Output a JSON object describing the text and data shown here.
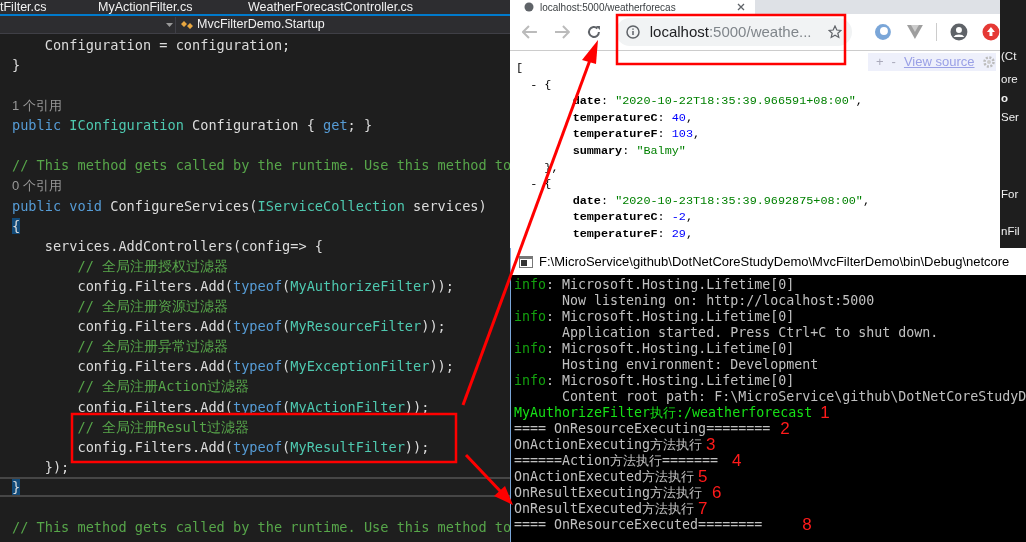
{
  "editor": {
    "tabs": [
      "tFilter.cs",
      "MyActionFilter.cs",
      "WeatherForecastController.cs"
    ],
    "member_dropdown": "MvcFilterDemo.Startup",
    "code_lines": [
      {
        "kind": "code",
        "tokens": [
          {
            "kind": "plain",
            "text": "    Configuration = configuration;"
          }
        ]
      },
      {
        "kind": "code",
        "tokens": [
          {
            "kind": "plain",
            "text": "}"
          }
        ]
      },
      {
        "kind": "blank"
      },
      {
        "kind": "codelens",
        "text": "1 个引用"
      },
      {
        "kind": "code",
        "tokens": [
          {
            "kind": "keyword",
            "text": "public "
          },
          {
            "kind": "type",
            "text": "IConfiguration"
          },
          {
            "kind": "plain",
            "text": " Configuration { "
          },
          {
            "kind": "keyword",
            "text": "get"
          },
          {
            "kind": "plain",
            "text": "; }"
          }
        ]
      },
      {
        "kind": "blank"
      },
      {
        "kind": "code",
        "tokens": [
          {
            "kind": "comment",
            "text": "// This method gets called by the runtime. Use this method to"
          }
        ]
      },
      {
        "kind": "codelens",
        "text": "0 个引用"
      },
      {
        "kind": "code",
        "tokens": [
          {
            "kind": "keyword",
            "text": "public void "
          },
          {
            "kind": "plain",
            "text": "ConfigureServices("
          },
          {
            "kind": "type",
            "text": "IServiceCollection"
          },
          {
            "kind": "plain",
            "text": " services)"
          }
        ]
      },
      {
        "kind": "code",
        "tokens": [
          {
            "kind": "brace",
            "text": "{"
          }
        ]
      },
      {
        "kind": "code",
        "tokens": [
          {
            "kind": "plain",
            "text": "    services.AddControllers(config=> {"
          }
        ]
      },
      {
        "kind": "code",
        "tokens": [
          {
            "kind": "comment",
            "text": "        // 全局注册授权过滤器"
          }
        ]
      },
      {
        "kind": "code",
        "tokens": [
          {
            "kind": "plain",
            "text": "        config.Filters.Add("
          },
          {
            "kind": "keyword",
            "text": "typeof"
          },
          {
            "kind": "plain",
            "text": "("
          },
          {
            "kind": "type",
            "text": "MyAuthorizeFilter"
          },
          {
            "kind": "plain",
            "text": "));"
          }
        ]
      },
      {
        "kind": "code",
        "tokens": [
          {
            "kind": "comment",
            "text": "        // 全局注册资源过滤器"
          }
        ]
      },
      {
        "kind": "code",
        "tokens": [
          {
            "kind": "plain",
            "text": "        config.Filters.Add("
          },
          {
            "kind": "keyword",
            "text": "typeof"
          },
          {
            "kind": "plain",
            "text": "("
          },
          {
            "kind": "type",
            "text": "MyResourceFilter"
          },
          {
            "kind": "plain",
            "text": "));"
          }
        ]
      },
      {
        "kind": "code",
        "tokens": [
          {
            "kind": "comment",
            "text": "        // 全局注册异常过滤器"
          }
        ]
      },
      {
        "kind": "code",
        "tokens": [
          {
            "kind": "plain",
            "text": "        config.Filters.Add("
          },
          {
            "kind": "keyword",
            "text": "typeof"
          },
          {
            "kind": "plain",
            "text": "("
          },
          {
            "kind": "type",
            "text": "MyExceptionFilter"
          },
          {
            "kind": "plain",
            "text": "));"
          }
        ]
      },
      {
        "kind": "code",
        "tokens": [
          {
            "kind": "comment",
            "text": "        // 全局注册Action过滤器"
          }
        ]
      },
      {
        "kind": "code",
        "tokens": [
          {
            "kind": "plain",
            "text": "        config.Filters.Add("
          },
          {
            "kind": "keyword",
            "text": "typeof"
          },
          {
            "kind": "plain",
            "text": "("
          },
          {
            "kind": "type",
            "text": "MyActionFilter"
          },
          {
            "kind": "plain",
            "text": "));"
          }
        ]
      },
      {
        "kind": "code",
        "tokens": [
          {
            "kind": "comment",
            "text": "        // 全局注册Result过滤器"
          }
        ]
      },
      {
        "kind": "code",
        "tokens": [
          {
            "kind": "plain",
            "text": "        config.Filters.Add("
          },
          {
            "kind": "keyword",
            "text": "typeof"
          },
          {
            "kind": "plain",
            "text": "("
          },
          {
            "kind": "type",
            "text": "MyResultFilter"
          },
          {
            "kind": "plain",
            "text": "));"
          }
        ]
      },
      {
        "kind": "code",
        "tokens": [
          {
            "kind": "plain",
            "text": "    });"
          }
        ]
      },
      {
        "kind": "current",
        "tokens": [
          {
            "kind": "brace",
            "text": "}"
          }
        ]
      },
      {
        "kind": "blank"
      },
      {
        "kind": "code",
        "tokens": [
          {
            "kind": "comment",
            "text": "// This method gets called by the runtime. Use this method to"
          }
        ]
      }
    ]
  },
  "browser": {
    "tab_title": "localhost:5000/weatherforecas",
    "address_host": "localhost",
    "address_rest": ":5000/weathe...",
    "viewer_controls": [
      "+",
      "-"
    ],
    "view_source": "View source",
    "json_lines": [
      [
        {
          "kind": "punct",
          "text": "["
        }
      ],
      [
        {
          "kind": "punct",
          "text": "  - {"
        }
      ],
      [
        {
          "kind": "key",
          "text": "        date"
        },
        {
          "kind": "punct",
          "text": ": "
        },
        {
          "kind": "string",
          "text": "\"2020-10-22T18:35:39.966591+08:00\""
        },
        {
          "kind": "punct",
          "text": ","
        }
      ],
      [
        {
          "kind": "key",
          "text": "        temperatureC"
        },
        {
          "kind": "punct",
          "text": ": "
        },
        {
          "kind": "number",
          "text": "40"
        },
        {
          "kind": "punct",
          "text": ","
        }
      ],
      [
        {
          "kind": "key",
          "text": "        temperatureF"
        },
        {
          "kind": "punct",
          "text": ": "
        },
        {
          "kind": "number",
          "text": "103"
        },
        {
          "kind": "punct",
          "text": ","
        }
      ],
      [
        {
          "kind": "key",
          "text": "        summary"
        },
        {
          "kind": "punct",
          "text": ": "
        },
        {
          "kind": "string",
          "text": "\"Balmy\""
        }
      ],
      [
        {
          "kind": "punct",
          "text": "    },"
        }
      ],
      [
        {
          "kind": "punct",
          "text": "  - {"
        }
      ],
      [
        {
          "kind": "key",
          "text": "        date"
        },
        {
          "kind": "punct",
          "text": ": "
        },
        {
          "kind": "string",
          "text": "\"2020-10-23T18:35:39.9692875+08:00\""
        },
        {
          "kind": "punct",
          "text": ","
        }
      ],
      [
        {
          "kind": "key",
          "text": "        temperatureC"
        },
        {
          "kind": "punct",
          "text": ": "
        },
        {
          "kind": "number",
          "text": "-2"
        },
        {
          "kind": "punct",
          "text": ","
        }
      ],
      [
        {
          "kind": "key",
          "text": "        temperatureF"
        },
        {
          "kind": "punct",
          "text": ": "
        },
        {
          "kind": "number",
          "text": "29"
        },
        {
          "kind": "punct",
          "text": ","
        }
      ]
    ]
  },
  "side_strip": [
    "(Ct",
    "ore",
    "o",
    "Ser",
    "For",
    "nFil"
  ],
  "console": {
    "title": "F:\\MicroService\\github\\DotNetCoreStudyDemo\\MvcFilterDemo\\bin\\Debug\\netcore",
    "lines": [
      {
        "kind": "info",
        "prefix": "info",
        "text": ": Microsoft.Hosting.Lifetime[0]"
      },
      {
        "kind": "plain",
        "text": "      Now listening on: http://localhost:5000"
      },
      {
        "kind": "info",
        "prefix": "info",
        "text": ": Microsoft.Hosting.Lifetime[0]"
      },
      {
        "kind": "plain",
        "text": "      Application started. Press Ctrl+C to shut down."
      },
      {
        "kind": "info",
        "prefix": "info",
        "text": ": Microsoft.Hosting.Lifetime[0]"
      },
      {
        "kind": "plain",
        "text": "      Hosting environment: Development"
      },
      {
        "kind": "info",
        "prefix": "info",
        "text": ": Microsoft.Hosting.Lifetime[0]"
      },
      {
        "kind": "plain",
        "text": "      Content root path: F:\\MicroService\\github\\DotNetCoreStudyD"
      },
      {
        "kind": "bright",
        "text": "MyAuthorizeFilter执行:/weatherforecast",
        "note": "1"
      },
      {
        "kind": "plain",
        "text": "==== OnResourceExecuting========",
        "note": "2"
      },
      {
        "kind": "plain",
        "text": "OnActionExecuting方法执行",
        "note": "3"
      },
      {
        "kind": "plain",
        "text": "======Action方法执行=======",
        "note": "4"
      },
      {
        "kind": "plain",
        "text": "OnActionExecuted方法执行",
        "note": "5"
      },
      {
        "kind": "plain",
        "text": "OnResultExecuting方法执行",
        "note": "6"
      },
      {
        "kind": "plain",
        "text": "OnResultExecuted方法执行",
        "note": "7"
      },
      {
        "kind": "plain",
        "text": "==== OnResourceExecuted========",
        "note": "8"
      }
    ]
  }
}
